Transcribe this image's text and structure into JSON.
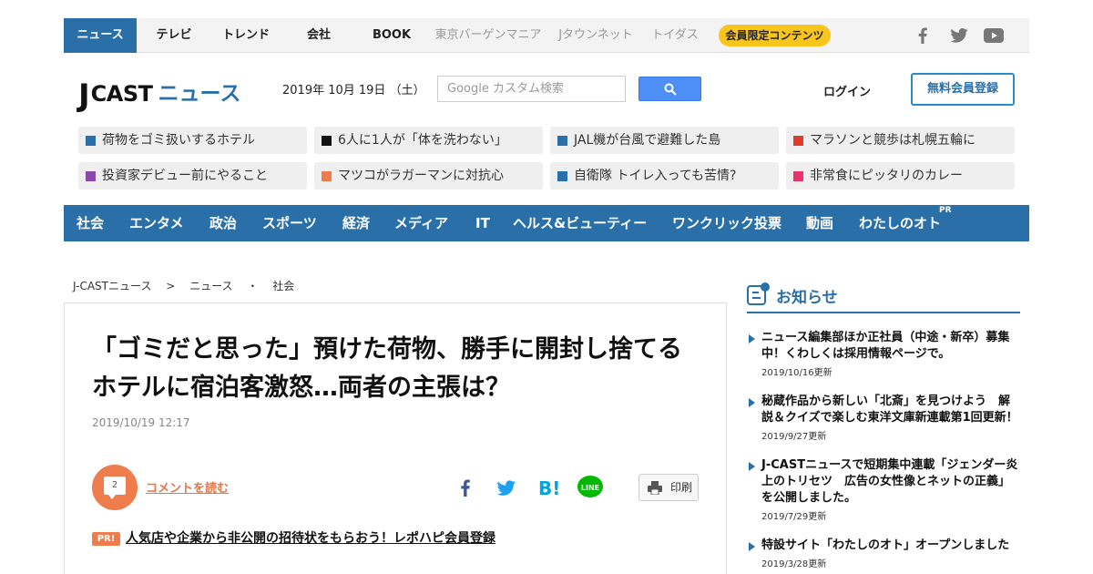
{
  "topnav": {
    "items": [
      {
        "label": "ニュース"
      },
      {
        "label": "テレビ"
      },
      {
        "label": "トレンド"
      },
      {
        "label": "会社"
      },
      {
        "label": "BOOK"
      },
      {
        "label": "東京バーゲンマニア"
      },
      {
        "label": "Jタウンネット"
      },
      {
        "label": "トイダス"
      }
    ],
    "member_label": "会員限定コンテンツ"
  },
  "header": {
    "logo_j": "J",
    "logo_cast": "CAST",
    "logo_news": "ニュース",
    "date": "2019年 10月 19日 （土）",
    "search_placeholder": "Google カスタム検索",
    "login_label": "ログイン",
    "signup_label": "無料会員登録"
  },
  "trending": [
    {
      "label": "荷物をゴミ扱いするホテル",
      "color": "#2a6fa8"
    },
    {
      "label": "6人に1人が「体を洗わない」",
      "color": "#111111"
    },
    {
      "label": "JAL機が台風で避難した島",
      "color": "#2a6fa8"
    },
    {
      "label": "マラソンと競歩は札幌五輪に",
      "color": "#e03a2a"
    },
    {
      "label": "投資家デビュー前にやること",
      "color": "#8a49a8"
    },
    {
      "label": "マツコがラガーマンに対抗心",
      "color": "#ee7c4c"
    },
    {
      "label": "自衛隊 トイレ入っても苦情?",
      "color": "#2a6fa8"
    },
    {
      "label": "非常食にピッタリのカレー",
      "color": "#e8336d"
    }
  ],
  "mainnav": {
    "items": [
      {
        "label": "社会"
      },
      {
        "label": "エンタメ"
      },
      {
        "label": "政治"
      },
      {
        "label": "スポーツ"
      },
      {
        "label": "経済"
      },
      {
        "label": "メディア"
      },
      {
        "label": "IT"
      },
      {
        "label": "ヘルス&ビューティー"
      },
      {
        "label": "ワンクリック投票"
      },
      {
        "label": "動画"
      },
      {
        "label": "わたしのオト"
      }
    ],
    "pr": "PR"
  },
  "breadcrumb": {
    "home": "J-CASTニュース",
    "sep1": ">",
    "news": "ニュース",
    "sep2": "・",
    "category": "社会"
  },
  "article": {
    "title": "「ゴミだと思った」預けた荷物、勝手に開封し捨てる　ホテルに宿泊客激怒…両者の主張は？",
    "date": "2019/10/19 12:17",
    "comment_count": "2",
    "comment_label": "コメントを読む",
    "print_label": "印刷",
    "pr_badge": "PR!",
    "pr_link": "人気店や企業から非公開の招待状をもらおう！レポハピ会員登録"
  },
  "sidebar": {
    "title": "お知らせ",
    "notices": [
      {
        "text": "ニュース編集部ほか正社員（中途・新卒）募集中！くわしくは採用情報ページで。",
        "date": "2019/10/16更新"
      },
      {
        "text": "秘蔵作品から新しい「北斎」を見つけよう　解説＆クイズで楽しむ東洋文庫新連載第1回更新！",
        "date": "2019/9/27更新"
      },
      {
        "text": "J-CASTニュースで短期集中連載「ジェンダー炎上のトリセツ　広告の女性像とネットの正義」を公開しました。",
        "date": "2019/7/29更新"
      },
      {
        "text": "特設サイト「わたしのオト」オープンしました",
        "date": "2019/3/28更新"
      }
    ]
  },
  "colors": {
    "brand": "#2a6fa8",
    "accent": "#ee7c4c",
    "member": "#f7c51e"
  }
}
